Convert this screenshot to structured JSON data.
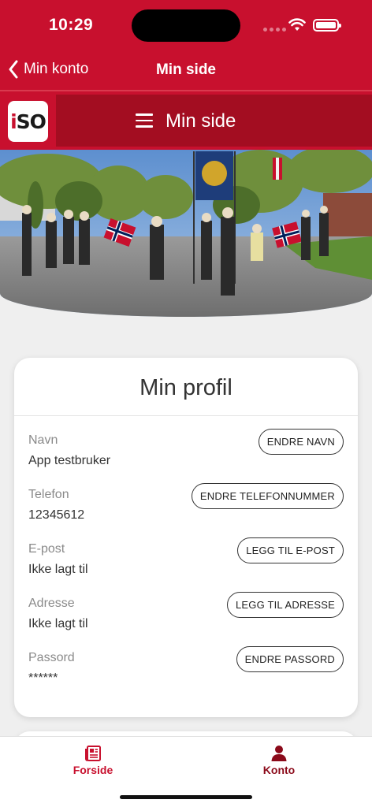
{
  "status_bar": {
    "time": "10:29"
  },
  "nav": {
    "back_label": "Min konto",
    "title": "Min side"
  },
  "app_header": {
    "logo_text_i": "i",
    "logo_text_so": "SO",
    "title": "Min side"
  },
  "hero": {
    "description_icon": "photo"
  },
  "profile": {
    "title": "Min profil",
    "rows": [
      {
        "label": "Navn",
        "value": "App testbruker",
        "button": "ENDRE NAVN"
      },
      {
        "label": "Telefon",
        "value": "12345612",
        "button": "ENDRE TELEFONNUMMER"
      },
      {
        "label": "E-post",
        "value": "Ikke lagt til",
        "button": "LEGG TIL E-POST"
      },
      {
        "label": "Adresse",
        "value": "Ikke lagt til",
        "button": "LEGG TIL ADRESSE"
      },
      {
        "label": "Passord",
        "value": "******",
        "button": "ENDRE PASSORD"
      }
    ]
  },
  "tabs": [
    {
      "label": "Forside",
      "icon": "newspaper-icon"
    },
    {
      "label": "Konto",
      "icon": "person-icon"
    }
  ],
  "colors": {
    "brand_red": "#c8102e",
    "dark_red": "#a30d21",
    "background": "#efefef"
  }
}
